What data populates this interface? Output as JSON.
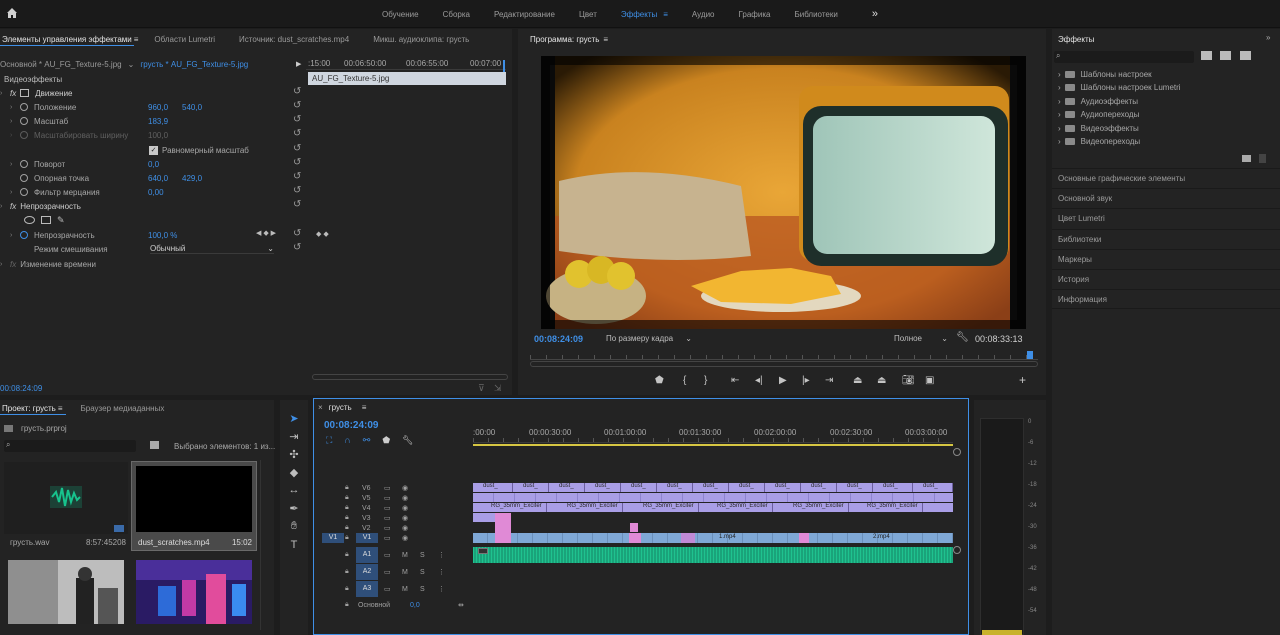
{
  "topbar": {
    "nav": [
      "Обучение",
      "Сборка",
      "Редактирование",
      "Цвет",
      "Эффекты",
      "Аудио",
      "Графика",
      "Библиотеки"
    ],
    "active": "Эффекты",
    "more": "»"
  },
  "effect_controls": {
    "tabs": [
      "Элементы управления эффектами",
      "Области Lumetri",
      "Источник: dust_scratches.mp4",
      "Микш. аудиоклипа: грусть"
    ],
    "source_clip": "Основной * AU_FG_Texture-5.jpg",
    "seq_clip": "грусть * AU_FG_Texture-5.jpg",
    "ruler": [
      "00:06:50:00",
      "00:06:55:00",
      "00:07:00"
    ],
    "ruler_start": ":15:00",
    "clip_bar": "AU_FG_Texture-5.jpg",
    "section_video": "Видеоэффекты",
    "motion": "Движение",
    "position_label": "Положение",
    "position_x": "960,0",
    "position_y": "540,0",
    "scale_label": "Масштаб",
    "scale_value": "183,9",
    "scale_width_label": "Масштабировать ширину",
    "scale_width_value": "100,0",
    "uniform_label": "Равномерный масштаб",
    "rotation_label": "Поворот",
    "rotation_value": "0,0",
    "anchor_label": "Опорная точка",
    "anchor_x": "640,0",
    "anchor_y": "429,0",
    "flicker_label": "Фильтр мерцания",
    "flicker_value": "0,00",
    "opacity_section": "Непрозрачность",
    "opacity_label": "Непрозрачность",
    "opacity_value": "100,0 %",
    "blend_label": "Режим смешивания",
    "blend_value": "Обычный",
    "time_remap": "Изменение времени",
    "timecode": "00:08:24:09"
  },
  "program": {
    "title": "Программа: грусть",
    "timecode": "00:08:24:09",
    "fit": "По размеру кадра",
    "quality": "Полное",
    "duration": "00:08:33:13",
    "playhead_fraction": 0.985
  },
  "effects_panel": {
    "title": "Эффекты",
    "items": [
      "Шаблоны настроек",
      "Шаблоны настроек Lumetri",
      "Аудиоэффекты",
      "Аудиопереходы",
      "Видеоэффекты",
      "Видеопереходы"
    ],
    "collapsed": [
      "Основные графические элементы",
      "Основной звук",
      "Цвет Lumetri",
      "Библиотеки",
      "Маркеры",
      "История",
      "Информация"
    ]
  },
  "project": {
    "tabs": [
      "Проект: грусть",
      "Браузер медиаданных"
    ],
    "file": "грусть.prproj",
    "selected_info": "Выбрано элементов: 1 из...",
    "items": [
      {
        "name": "грусть.wav",
        "duration": "8:57:45208"
      },
      {
        "name": "dust_scratches.mp4",
        "duration": "15:02"
      }
    ]
  },
  "timeline": {
    "title": "грусть",
    "timecode": "00:08:24:09",
    "ruler": [
      ":00:00",
      "00:00:30:00",
      "00:01:00:00",
      "00:01:30:00",
      "00:02:00:00",
      "00:02:30:00",
      "00:03:00:00"
    ],
    "video_tracks": [
      "V6",
      "V5",
      "V4",
      "V3",
      "V2",
      "V1"
    ],
    "audio_tracks": [
      "A1",
      "A2",
      "A3"
    ],
    "source_v1": "V1",
    "master_label": "Основной",
    "master_value": "0,0",
    "m_label": "M",
    "s_label": "S",
    "clip_dust": "dust_",
    "clip_rg": "RG_35mm_Exciter",
    "clip_v1_a": "1.mp4",
    "clip_v1_b": "2.mp4"
  },
  "meter": {
    "db": [
      "0",
      "-6",
      "-12",
      "-18",
      "-24",
      "-30",
      "-36",
      "-42",
      "-48",
      "-54"
    ]
  }
}
